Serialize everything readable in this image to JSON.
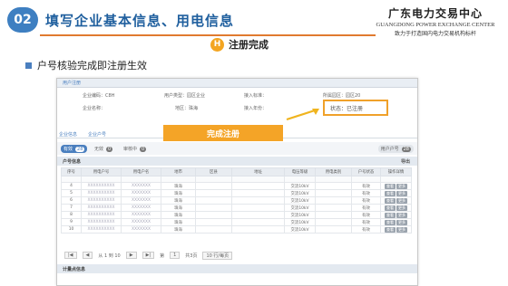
{
  "slide": {
    "number": "02",
    "title": "填写企业基本信息、用电信息",
    "brand_cn": "广东电力交易中心",
    "brand_en": "GUANGDONG POWER EXCHANGE CENTER",
    "brand_slogan": "致力于打造国内电力交易机构标杆",
    "step_letter": "H",
    "step_title": "注册完成",
    "bullet": "户号核验完成即注册生效"
  },
  "app": {
    "tab_label": "用户注册",
    "info": {
      "company_code": "企业编码：C8H",
      "user_type": "用户类型：园区企业",
      "access_standard": "接入标准：",
      "park": "所属园区：园区20",
      "company_name": "企业名称：",
      "region": "地区：珠海",
      "access_year": "接入年份：",
      "status": "状态：已注册"
    },
    "subtabs": [
      "企业信息",
      "企业户号"
    ],
    "filters": [
      {
        "label": "有效",
        "count": "28"
      },
      {
        "label": "无效",
        "count": "0"
      },
      {
        "label": "审核中",
        "count": "0"
      }
    ],
    "filter_right": {
      "label": "用户户号",
      "count": "28"
    },
    "done_banner": "完成注册",
    "account_section": "户号信息",
    "export_label": "导出",
    "columns": [
      "序号",
      "用电户号",
      "用电户名",
      "地市",
      "区县",
      "地址",
      "电压等级",
      "用电类别",
      "户号状态",
      "操作详情"
    ],
    "rows": [
      {
        "no": "4",
        "acc": "XXXXXXXXXX",
        "name": "XXXXXXX",
        "city": "珠海",
        "volt": "交流10kV",
        "cat": "",
        "state": "有效"
      },
      {
        "no": "5",
        "acc": "XXXXXXXXXX",
        "name": "XXXXXXX",
        "city": "珠海",
        "volt": "交流10kV",
        "cat": "",
        "state": "有效"
      },
      {
        "no": "6",
        "acc": "XXXXXXXXXX",
        "name": "XXXXXXX",
        "city": "珠海",
        "volt": "交流10kV",
        "cat": "",
        "state": "有效"
      },
      {
        "no": "7",
        "acc": "XXXXXXXXXX",
        "name": "XXXXXXX",
        "city": "珠海",
        "volt": "交流10kV",
        "cat": "",
        "state": "有效"
      },
      {
        "no": "8",
        "acc": "XXXXXXXXXX",
        "name": "XXXXXXX",
        "city": "珠海",
        "volt": "交流10kV",
        "cat": "",
        "state": "有效"
      },
      {
        "no": "9",
        "acc": "XXXXXXXXXX",
        "name": "XXXXXXX",
        "city": "珠海",
        "volt": "交流10kV",
        "cat": "",
        "state": "有效"
      },
      {
        "no": "10",
        "acc": "XXXXXXXXXX",
        "name": "XXXXXXX",
        "city": "珠海",
        "volt": "交流10kV",
        "cat": "",
        "state": "有效"
      }
    ],
    "op_labels": [
      "查看",
      "更多"
    ],
    "pager": {
      "range": "从 1 到 10",
      "page_label": "第",
      "page_value": "1",
      "of_pages": "共3页",
      "page_size": "10 行/每页"
    },
    "meter_section": "计量点信息"
  },
  "colors": {
    "accent": "#f4a427",
    "primary": "#4a7fbf",
    "title": "#1f5f9e"
  }
}
